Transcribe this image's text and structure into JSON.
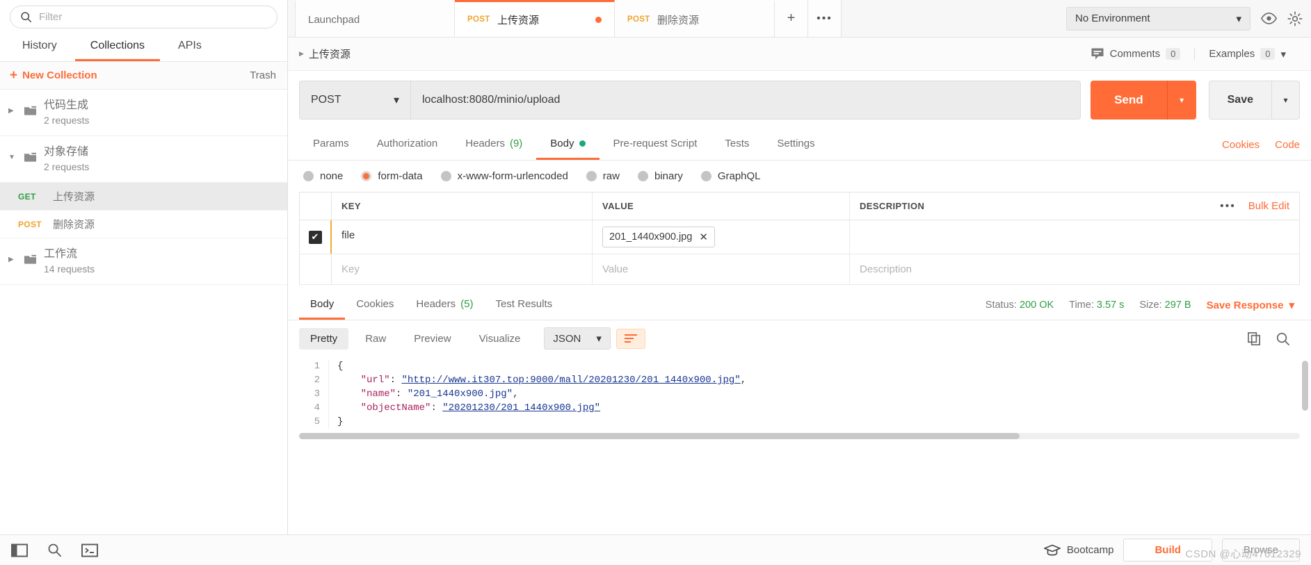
{
  "sidebar": {
    "filter_placeholder": "Filter",
    "tabs": [
      {
        "label": "History",
        "active": false
      },
      {
        "label": "Collections",
        "active": true
      },
      {
        "label": "APIs",
        "active": false
      }
    ],
    "new_collection_label": "New Collection",
    "trash_label": "Trash",
    "tree": [
      {
        "name": "代码生成",
        "count": "2 requests",
        "expanded": false
      },
      {
        "name": "对象存储",
        "count": "2 requests",
        "expanded": true
      },
      {
        "name": "工作流",
        "count": "14 requests",
        "expanded": false
      }
    ],
    "requests": [
      {
        "method": "GET",
        "name": "上传资源",
        "selected": true
      },
      {
        "method": "POST",
        "name": "删除资源",
        "selected": false
      }
    ]
  },
  "tabbar": {
    "tabs": [
      {
        "method": "",
        "label": "Launchpad",
        "active": false,
        "unsaved": false
      },
      {
        "method": "POST",
        "label": "上传资源",
        "active": true,
        "unsaved": true
      },
      {
        "method": "POST",
        "label": "删除资源",
        "active": false,
        "unsaved": false
      }
    ],
    "new_tab_icon": "plus-icon",
    "more_icon": "ellipsis-icon",
    "environment": "No Environment",
    "eye_icon": "eye-icon",
    "gear_icon": "gear-icon"
  },
  "breadcrumb": {
    "title": "上传资源",
    "comments_label": "Comments",
    "comments_count": "0",
    "examples_label": "Examples",
    "examples_count": "0"
  },
  "request": {
    "method": "POST",
    "url": "localhost:8080/minio/upload",
    "send_label": "Send",
    "save_label": "Save",
    "tabs": [
      {
        "label": "Params",
        "active": false,
        "badge": ""
      },
      {
        "label": "Authorization",
        "active": false,
        "badge": ""
      },
      {
        "label": "Headers",
        "active": false,
        "badge": "(9)"
      },
      {
        "label": "Body",
        "active": true,
        "badge": ""
      },
      {
        "label": "Pre-request Script",
        "active": false,
        "badge": ""
      },
      {
        "label": "Tests",
        "active": false,
        "badge": ""
      },
      {
        "label": "Settings",
        "active": false,
        "badge": ""
      }
    ],
    "right_links": [
      {
        "label": "Cookies"
      },
      {
        "label": "Code"
      }
    ],
    "body_types": [
      {
        "label": "none",
        "selected": false
      },
      {
        "label": "form-data",
        "selected": true
      },
      {
        "label": "x-www-form-urlencoded",
        "selected": false
      },
      {
        "label": "raw",
        "selected": false
      },
      {
        "label": "binary",
        "selected": false
      },
      {
        "label": "GraphQL",
        "selected": false
      }
    ],
    "table": {
      "columns": [
        "KEY",
        "VALUE",
        "DESCRIPTION"
      ],
      "bulk_edit_label": "Bulk Edit",
      "more_icon": "ellipsis-icon",
      "rows": [
        {
          "checked": true,
          "key": "file",
          "value": "201_1440x900.jpg",
          "value_is_file": true,
          "description": ""
        }
      ],
      "placeholder_row": {
        "key": "Key",
        "value": "Value",
        "description": "Description"
      }
    }
  },
  "response": {
    "tabs": [
      {
        "label": "Body",
        "active": true,
        "badge": ""
      },
      {
        "label": "Cookies",
        "active": false,
        "badge": ""
      },
      {
        "label": "Headers",
        "active": false,
        "badge": "(5)"
      },
      {
        "label": "Test Results",
        "active": false,
        "badge": ""
      }
    ],
    "status_label": "Status:",
    "status_value": "200 OK",
    "time_label": "Time:",
    "time_value": "3.57 s",
    "size_label": "Size:",
    "size_value": "297 B",
    "save_response_label": "Save Response",
    "view_tabs": [
      {
        "label": "Pretty",
        "active": true
      },
      {
        "label": "Raw",
        "active": false
      },
      {
        "label": "Preview",
        "active": false
      },
      {
        "label": "Visualize",
        "active": false
      }
    ],
    "format": "JSON",
    "wrap_icon": "word-wrap-icon",
    "copy_icon": "copy-icon",
    "search_icon": "search-icon",
    "line_numbers": [
      "1",
      "2",
      "3",
      "4",
      "5"
    ],
    "json": {
      "open_brace": "{",
      "close_brace": "}",
      "entries": [
        {
          "key": "\"url\"",
          "value": "\"http://www.it307.top:9000/mall/20201230/201_1440x900.jpg\"",
          "link": true,
          "comma": ","
        },
        {
          "key": "\"name\"",
          "value": "\"201_1440x900.jpg\"",
          "link": false,
          "comma": ","
        },
        {
          "key": "\"objectName\"",
          "value": "\"20201230/201_1440x900.jpg\"",
          "link": true,
          "comma": ""
        }
      ]
    }
  },
  "footer": {
    "sidebar_toggle_icon": "panel-toggle-icon",
    "search_icon": "search-icon",
    "console_icon": "console-icon",
    "bootcamp_label": "Bootcamp",
    "build_label": "Build",
    "browse_label": "Browse",
    "watermark": "CSDN @心动47612329"
  },
  "colors": {
    "accent": "#ff6c37",
    "get": "#2f9e44",
    "post": "#f0a32d",
    "success": "#2f9e44"
  }
}
